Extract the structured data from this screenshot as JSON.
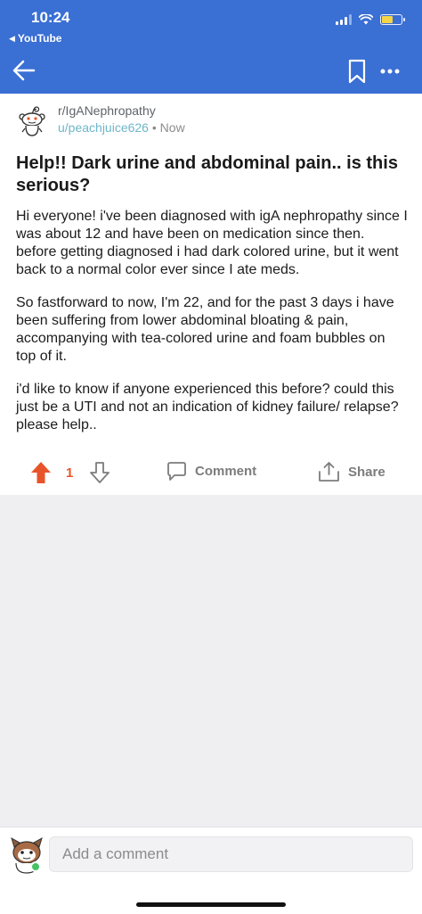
{
  "status_bar": {
    "time": "10:24",
    "back_app": "YouTube"
  },
  "post": {
    "subreddit": "r/IgANephropathy",
    "username": "u/peachjuice626",
    "separator": "•",
    "time_ago": "Now",
    "title": "Help!! Dark urine and abdominal pain.. is this serious?",
    "paragraphs": [
      "Hi everyone! i've been diagnosed with igA nephropathy since I was about 12 and have been on medication since then. before getting diagnosed i had dark colored urine, but it went back to a normal color ever since I ate meds.",
      "So fastforward to now, I'm 22, and for the past 3 days i have been suffering from lower abdominal bloating & pain, accompanying with tea-colored urine and foam bubbles on top of it.",
      "i'd like to know if anyone experienced this before? could this just be a UTI and not an indication of kidney failure/ relapse? please help.."
    ],
    "vote_count": "1",
    "comment_label": "Comment",
    "share_label": "Share"
  },
  "comment_bar": {
    "placeholder": "Add a comment"
  },
  "colors": {
    "header": "#3a6fd4",
    "upvote": "#e8542a",
    "username": "#6db6c9",
    "online": "#46c165",
    "battery": "#f5d547"
  },
  "icons": [
    "back-arrow-icon",
    "bookmark-icon",
    "more-icon",
    "snoo-icon",
    "upvote-icon",
    "downvote-icon",
    "comment-icon",
    "share-icon",
    "user-avatar-icon"
  ]
}
